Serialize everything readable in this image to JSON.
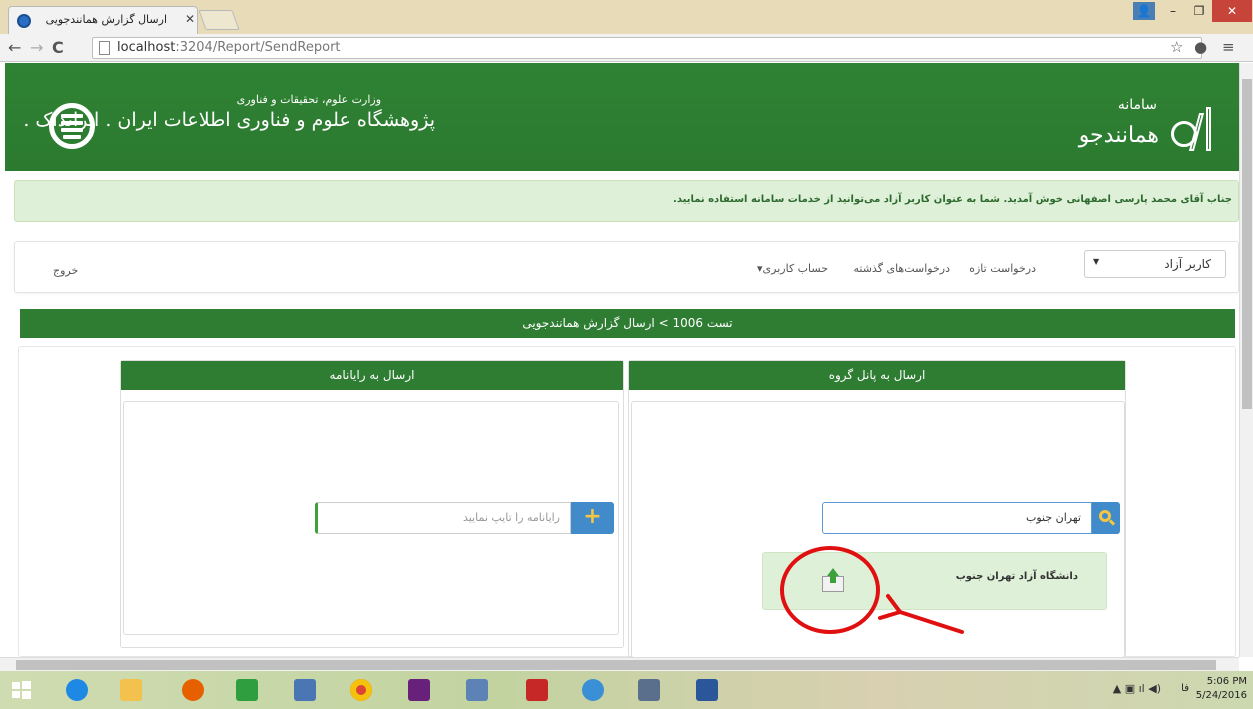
{
  "browser": {
    "tab_title": "ارسال گزارش همانندجویی",
    "url_host": "localhost",
    "url_rest": ":3204/Report/SendReport"
  },
  "header": {
    "ministry_line": "وزارت علوم، تحقیقات و فناوری",
    "institute_name": "پژوهشگاه علوم و فناوری اطلاعات ایران",
    "institute_short": "ایرانداک",
    "system_label": "سامانه",
    "system_name": "همانندجو"
  },
  "welcome_message": "جناب آقای محمد پارسی اصفهانی خوش آمدید. شما به عنوان کاربر آزاد می‌توانید از خدمات سامانه استفاده نمایید.",
  "nav": {
    "role_value": "کاربر آزاد",
    "new_request": "درخواست تازه",
    "past_requests": "درخواست‌های گذشته",
    "user_account": "حساب کاربری▾",
    "logout": "خروج"
  },
  "breadcrumb": "تست 1006 > ارسال گزارش همانندجویی",
  "panel_group": {
    "title": "ارسال به پانل گروه",
    "search_value": "تهران جنوب",
    "result_label": "دانشگاه آزاد تهران جنوب"
  },
  "panel_email": {
    "title": "ارسال به رایانامه",
    "placeholder": "رایانامه را تایپ نمایید",
    "add_label": "+"
  },
  "taskbar": {
    "lang": "فا",
    "time": "5:06 PM",
    "date": "5/24/2016",
    "apps": [
      "start",
      "internet-explorer",
      "file-explorer",
      "firefox",
      "store",
      "remote-desktop",
      "chrome",
      "visual-studio",
      "screen-tool",
      "acrobat",
      "network-tool",
      "floppy-tool",
      "word"
    ]
  },
  "colors": {
    "primary_green": "#2e7d32",
    "alert_green": "#dff0d8",
    "button_blue": "#428bca",
    "annotation_red": "#e01010"
  }
}
